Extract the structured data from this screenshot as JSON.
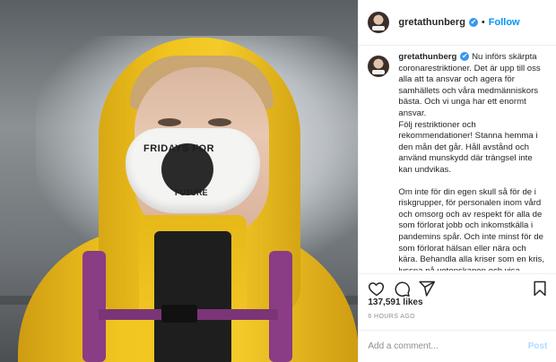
{
  "header": {
    "username": "gretathunberg",
    "verified_mark": "✔",
    "separator": "•",
    "follow_label": "Follow"
  },
  "caption": {
    "username": "gretathunberg",
    "paragraphs": [
      "Nu införs skärpta coronarestriktioner. Det är upp till oss alla att ta ansvar och agera för samhällets och våra medmänniskors bästa. Och vi unga har ett enormt ansvar.\nFölj restriktioner och rekommendationer! Stanna hemma i den mån det går. Håll avstånd och använd munskydd där trängsel inte kan undvikas.",
      "Om inte för din egen skull så för de i riskgrupper, för personalen inom vård och omsorg och av respekt för alla de som förlorat jobb och inkomstkälla i pandemins spår. Och inte minst för de som förlorat hälsan eller nära och kära. Behandla alla kriser som en kris, lyssna på vetenskapen och visa solidaritet."
    ]
  },
  "photo": {
    "mask_text_top": "FRIDAYS FOR",
    "mask_text_bottom": "FUTURE"
  },
  "actions": {
    "like_icon": "heart-icon",
    "comment_icon": "comment-icon",
    "share_icon": "send-icon",
    "save_icon": "bookmark-icon"
  },
  "likes": "137,591 likes",
  "timestamp": "6 HOURS AGO",
  "comment_box": {
    "placeholder": "Add a comment...",
    "post_label": "Post"
  },
  "colors": {
    "link_blue": "#0095f6",
    "verified_blue": "#3897f0",
    "post_disabled": "#b3dbff",
    "raincoat_yellow": "#f2c51d"
  }
}
